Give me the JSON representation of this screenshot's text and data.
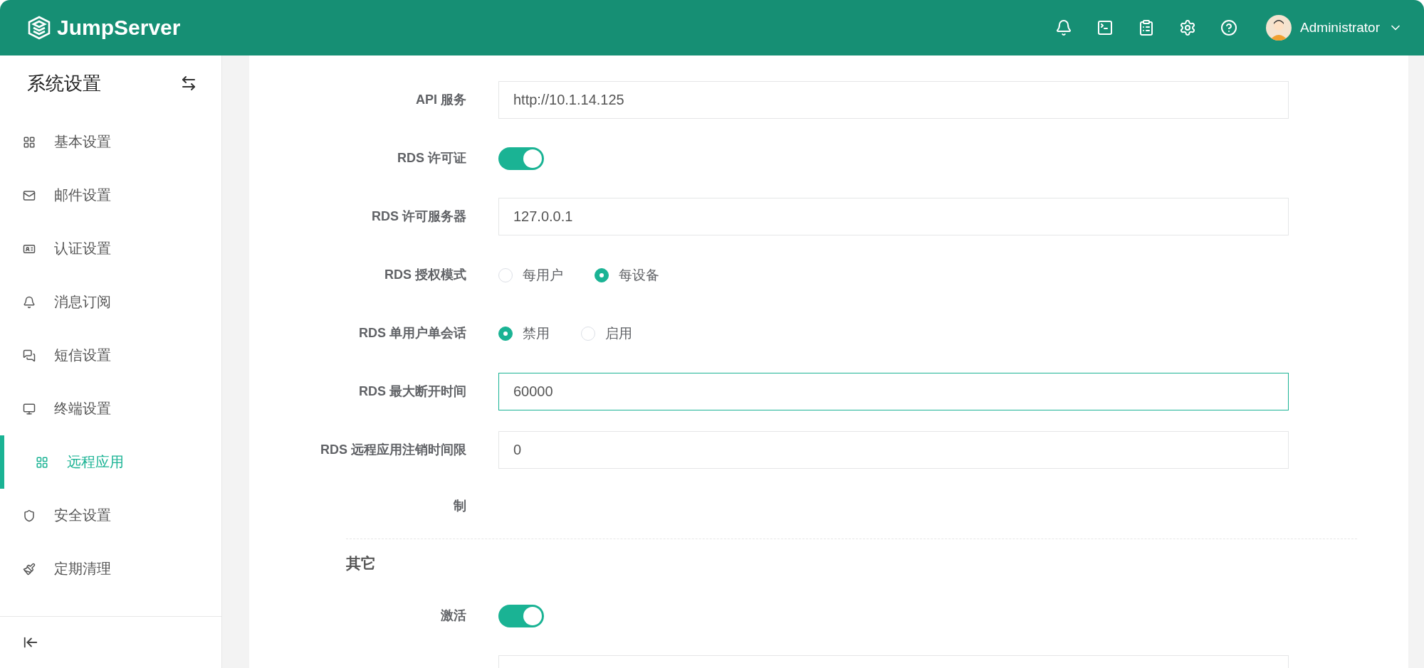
{
  "header": {
    "logo_text": "JumpServer",
    "user": "Administrator"
  },
  "sidebar": {
    "title": "系统设置",
    "items": [
      {
        "label": "基本设置",
        "selected": false
      },
      {
        "label": "邮件设置",
        "selected": false
      },
      {
        "label": "认证设置",
        "selected": false
      },
      {
        "label": "消息订阅",
        "selected": false
      },
      {
        "label": "短信设置",
        "selected": false
      },
      {
        "label": "终端设置",
        "selected": false
      },
      {
        "label": "远程应用",
        "selected": true
      },
      {
        "label": "安全设置",
        "selected": false
      },
      {
        "label": "定期清理",
        "selected": false
      }
    ]
  },
  "form": {
    "rows": [
      {
        "kind": "input",
        "label": "API 服务",
        "value": "http://10.1.14.125",
        "focused": false
      },
      {
        "kind": "switch",
        "label": "RDS 许可证",
        "on": true
      },
      {
        "kind": "input",
        "label": "RDS 许可服务器",
        "value": "127.0.0.1",
        "focused": false
      },
      {
        "kind": "radio",
        "label": "RDS 授权模式",
        "options": [
          {
            "label": "每用户",
            "selected": false
          },
          {
            "label": "每设备",
            "selected": true
          }
        ]
      },
      {
        "kind": "radio",
        "label": "RDS 单用户单会话",
        "options": [
          {
            "label": "禁用",
            "selected": true
          },
          {
            "label": "启用",
            "selected": false
          }
        ]
      },
      {
        "kind": "input",
        "label": "RDS 最大断开时间",
        "value": "60000",
        "focused": true
      },
      {
        "kind": "input",
        "label": "RDS 远程应用注销时间限制",
        "value": "0",
        "focused": false
      }
    ],
    "section_title": "其它",
    "other_rows": [
      {
        "kind": "switch",
        "label": "激活",
        "on": true
      },
      {
        "kind": "input",
        "focused": false
      }
    ]
  }
}
